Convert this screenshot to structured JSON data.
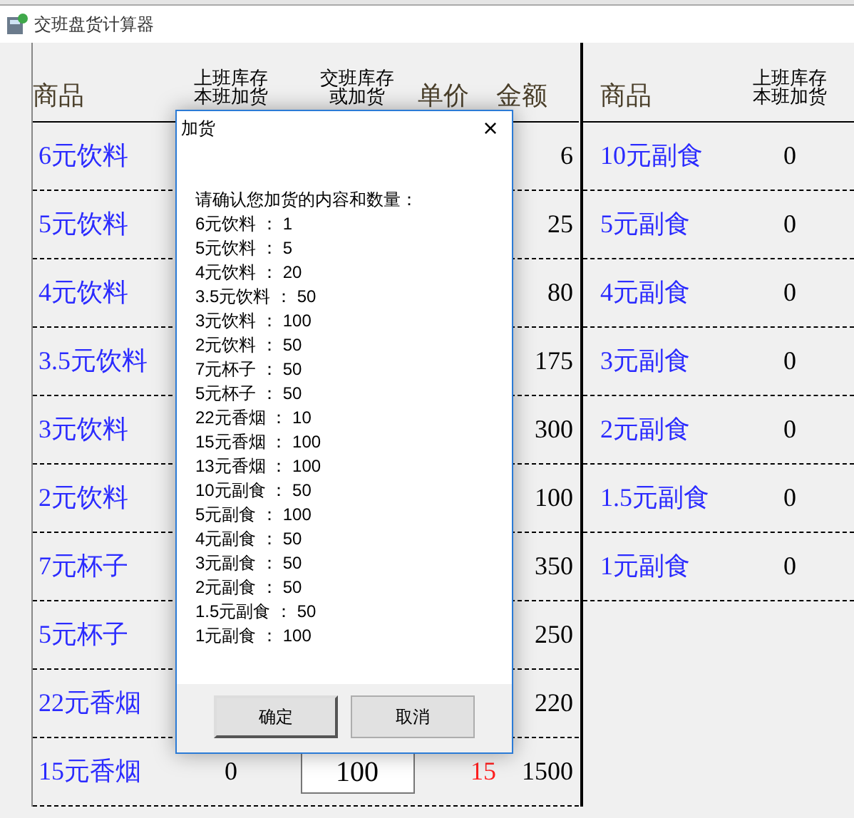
{
  "window": {
    "title": "交班盘货计算器"
  },
  "left_table": {
    "columns": [
      "商品",
      [
        "上班库存",
        "本班加货"
      ],
      [
        "交班库存",
        "或加货"
      ],
      "单价",
      "金额"
    ],
    "rows": [
      {
        "name": "6元饮料",
        "amount": "6"
      },
      {
        "name": "5元饮料",
        "amount": "25"
      },
      {
        "name": "4元饮料",
        "amount": "80"
      },
      {
        "name": "3.5元饮料",
        "amount": "175"
      },
      {
        "name": "3元饮料",
        "amount": "300"
      },
      {
        "name": "2元饮料",
        "amount": "100"
      },
      {
        "name": "7元杯子",
        "amount": "350"
      },
      {
        "name": "5元杯子",
        "amount": "250"
      },
      {
        "name": "22元香烟",
        "amount": "220"
      },
      {
        "name": "15元香烟",
        "stock": "0",
        "input": "100",
        "price": "15",
        "amount": "1500"
      }
    ]
  },
  "right_table": {
    "columns": [
      "商品",
      [
        "上班库存",
        "本班加货"
      ]
    ],
    "rows": [
      {
        "name": "10元副食",
        "stock": "0"
      },
      {
        "name": "5元副食",
        "stock": "0"
      },
      {
        "name": "4元副食",
        "stock": "0"
      },
      {
        "name": "3元副食",
        "stock": "0"
      },
      {
        "name": "2元副食",
        "stock": "0"
      },
      {
        "name": "1.5元副食",
        "stock": "0"
      },
      {
        "name": "1元副食",
        "stock": "0"
      }
    ]
  },
  "dialog": {
    "title": "加货",
    "close": "×",
    "message": "请确认您加货的内容和数量：",
    "lines": [
      "6元饮料 ： 1",
      "5元饮料 ： 5",
      "4元饮料 ： 20",
      "3.5元饮料 ： 50",
      "3元饮料 ： 100",
      "2元饮料 ： 50",
      "7元杯子 ： 50",
      "5元杯子 ： 50",
      "22元香烟 ： 10",
      "15元香烟 ： 100",
      "13元香烟 ： 100",
      "10元副食 ： 50",
      "5元副食 ： 100",
      "4元副食 ： 50",
      "3元副食 ： 50",
      "2元副食 ： 50",
      "1.5元副食 ： 50",
      "1元副食 ： 100"
    ],
    "buttons": [
      {
        "label": "确定",
        "default": true
      },
      {
        "label": "取消",
        "default": false
      }
    ]
  }
}
